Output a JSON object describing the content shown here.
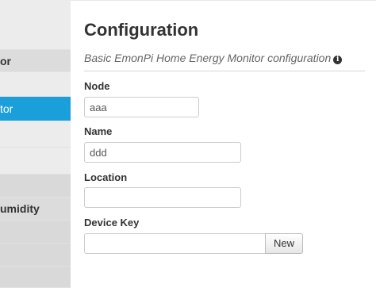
{
  "sidebar": {
    "items": [
      {
        "label": ""
      },
      {
        "label": "or"
      },
      {
        "label": ""
      },
      {
        "label": "tor"
      },
      {
        "label": ""
      },
      {
        "label": ""
      },
      {
        "label": ""
      },
      {
        "label": "umidity"
      },
      {
        "label": ""
      },
      {
        "label": ""
      },
      {
        "label": ""
      }
    ]
  },
  "page": {
    "title": "Configuration",
    "subtitle": "Basic EmonPi Home Energy Monitor configuration",
    "info_icon": "info-circle-icon"
  },
  "form": {
    "node": {
      "label": "Node",
      "value": "aaa"
    },
    "name": {
      "label": "Name",
      "value": "ddd"
    },
    "location": {
      "label": "Location",
      "value": ""
    },
    "device_key": {
      "label": "Device Key",
      "value": "",
      "button_label": "New"
    }
  },
  "colors": {
    "accent": "#1a9fdb",
    "sidebar_bg": "#ececec"
  }
}
